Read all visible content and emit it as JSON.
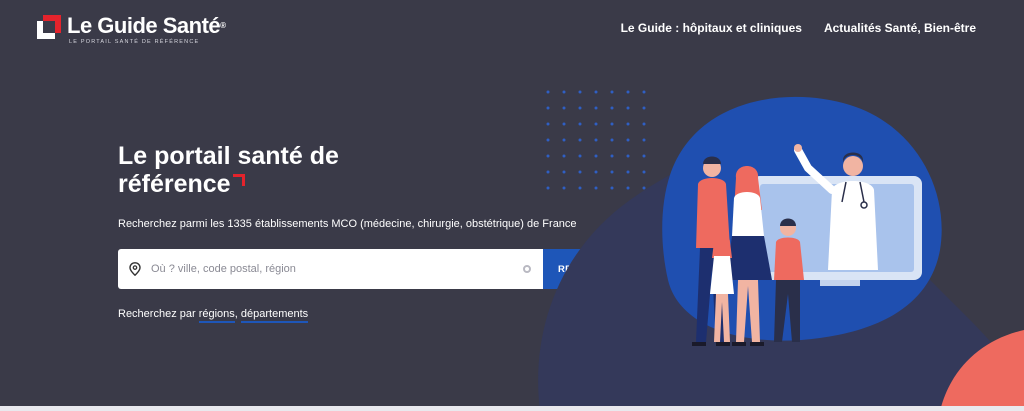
{
  "header": {
    "logo": {
      "name": "Le Guide Santé",
      "registered": "®",
      "tagline": "LE PORTAIL SANTÉ DE RÉFÉRENCE"
    },
    "nav": [
      {
        "label": "Le Guide : hôpitaux et cliniques"
      },
      {
        "label": "Actualités Santé, Bien-être"
      }
    ]
  },
  "hero": {
    "title_line1": "Le portail santé de",
    "title_line2": "référence",
    "subtitle": "Recherchez parmi les 1335 établissements MCO (médecine, chirurgie, obstétrique) de France"
  },
  "search": {
    "placeholder": "Où ? ville, code postal, région",
    "value": "",
    "button_label": "RECHERCHER"
  },
  "browse": {
    "prefix": "Recherchez par ",
    "regions_label": "régions",
    "separator": ", ",
    "departments_label": "départements"
  },
  "colors": {
    "background": "#3a3a48",
    "accent_red": "#e4232c",
    "button_blue": "#1e56b8",
    "blob_blue": "#1f4fb0",
    "coral": "#ee6a5f"
  }
}
